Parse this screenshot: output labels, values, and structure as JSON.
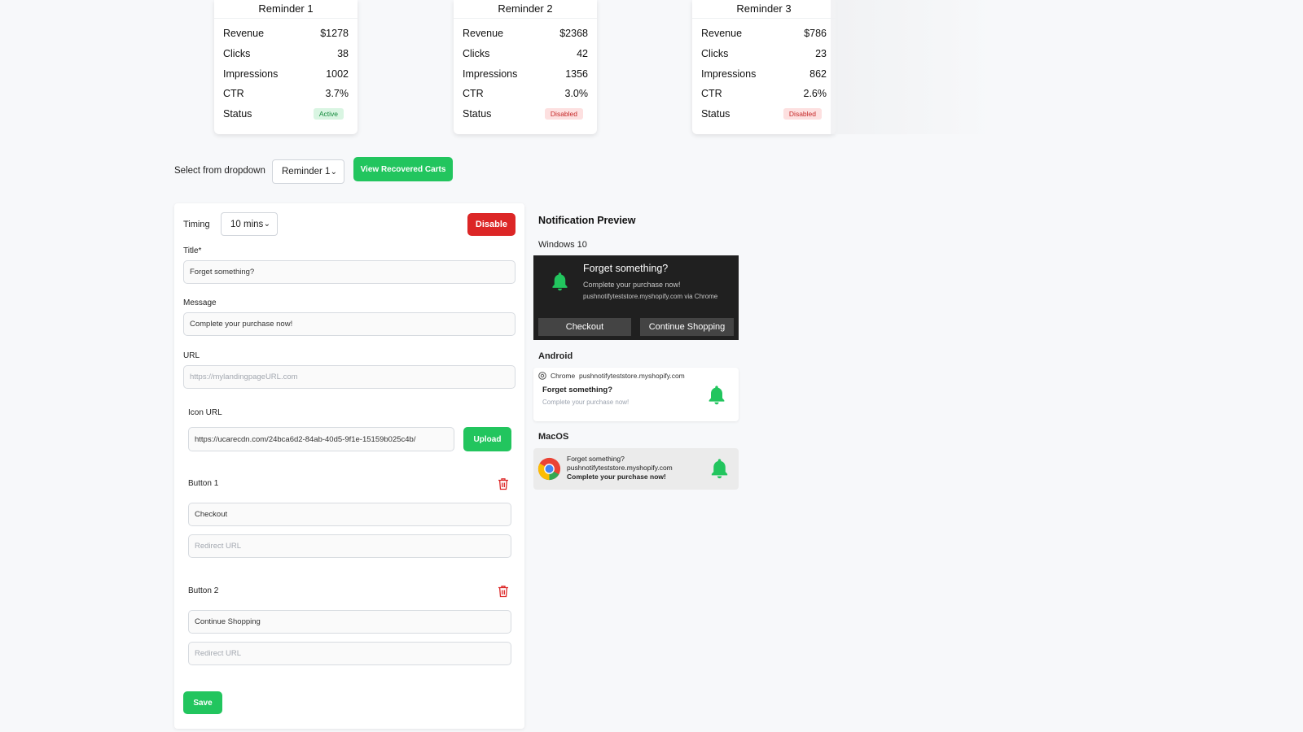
{
  "reminders": [
    {
      "title": "Reminder 1",
      "rows": [
        {
          "label": "Revenue",
          "value": "$1278"
        },
        {
          "label": "Clicks",
          "value": "38"
        },
        {
          "label": "Impressions",
          "value": "1002"
        },
        {
          "label": "CTR",
          "value": "3.7%"
        }
      ],
      "status_label": "Status",
      "status": "Active"
    },
    {
      "title": "Reminder 2",
      "rows": [
        {
          "label": "Revenue",
          "value": "$2368"
        },
        {
          "label": "Clicks",
          "value": "42"
        },
        {
          "label": "Impressions",
          "value": "1356"
        },
        {
          "label": "CTR",
          "value": "3.0%"
        }
      ],
      "status_label": "Status",
      "status": "Disabled"
    },
    {
      "title": "Reminder 3",
      "rows": [
        {
          "label": "Revenue",
          "value": "$786"
        },
        {
          "label": "Clicks",
          "value": "23"
        },
        {
          "label": "Impressions",
          "value": "862"
        },
        {
          "label": "CTR",
          "value": "2.6%"
        }
      ],
      "status_label": "Status",
      "status": "Disabled"
    }
  ],
  "controls": {
    "dropdown_label": "Select from dropdown",
    "dropdown_value": "Reminder 1",
    "view_carts": "View Recovered Carts"
  },
  "form": {
    "timing_label": "Timing",
    "timing_value": "10 mins",
    "disable_button": "Disable",
    "title_label": "Title*",
    "title_value": "Forget something?",
    "message_label": "Message",
    "message_value": "Complete your purchase now!",
    "url_label": "URL",
    "url_placeholder": "https://mylandingpageURL.com",
    "icon_url_label": "Icon URL",
    "icon_url_value": "https://ucarecdn.com/24bca6d2-84ab-40d5-9f1e-15159b025c4b/",
    "upload_button": "Upload",
    "button1_label": "Button 1",
    "button1_text": "Checkout",
    "button1_redirect_placeholder": "Redirect URL",
    "button2_label": "Button 2",
    "button2_text": "Continue Shopping",
    "button2_redirect_placeholder": "Redirect URL",
    "save_button": "Save"
  },
  "preview": {
    "title": "Notification Preview",
    "windows": {
      "label": "Windows 10",
      "title": "Forget something?",
      "message": "Complete your purchase now!",
      "source": "pushnotifyteststore.myshopify.com via Chrome",
      "btn1": "Checkout",
      "btn2": "Continue Shopping"
    },
    "android": {
      "label": "Android",
      "app": "Chrome",
      "domain": "pushnotifyteststore.myshopify.com",
      "title": "Forget something?",
      "message": "Complete your purchase now!"
    },
    "macos": {
      "label": "MacOS",
      "title": "Forget something?",
      "domain": "pushnotifyteststore.myshopify.com",
      "message": "Complete your purchase now!"
    }
  },
  "colors": {
    "green": "#22c55e",
    "red": "#dc2626",
    "dark": "#202020"
  },
  "icons": [
    "bell-icon",
    "trash-icon",
    "chrome-icon",
    "chevron-down-icon"
  ]
}
